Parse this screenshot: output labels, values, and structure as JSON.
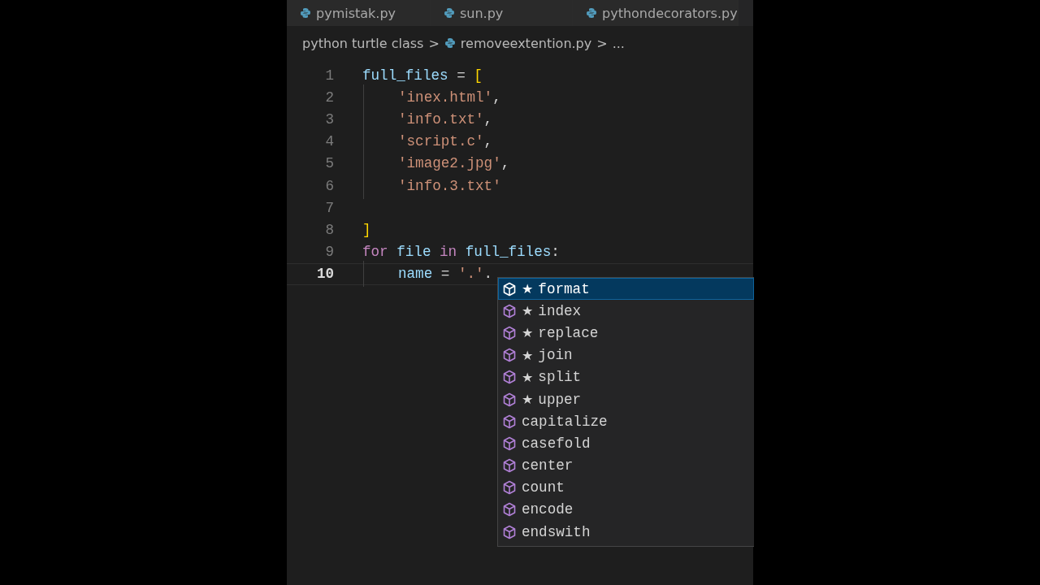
{
  "tabs": [
    {
      "label": "pymistak.py",
      "selected": false
    },
    {
      "label": "sun.py",
      "selected": false
    },
    {
      "label": "pythondecorators.py",
      "selected": false
    }
  ],
  "breadcrumb": {
    "folder": "python turtle class",
    "separator_1": ">",
    "file": "removeextention.py",
    "separator_2": ">",
    "more": "..."
  },
  "code_lines": [
    {
      "number": "1",
      "indented": false,
      "current": false,
      "tokens": [
        {
          "kind": "variable",
          "text": "full_files"
        },
        {
          "kind": "operator",
          "text": " = "
        },
        {
          "kind": "bracket",
          "text": "["
        }
      ]
    },
    {
      "number": "2",
      "indented": true,
      "current": false,
      "tokens": [
        {
          "kind": "string",
          "text": "'inex.html'"
        },
        {
          "kind": "operator",
          "text": ","
        }
      ]
    },
    {
      "number": "3",
      "indented": true,
      "current": false,
      "tokens": [
        {
          "kind": "string",
          "text": "'info.txt'"
        },
        {
          "kind": "operator",
          "text": ","
        }
      ]
    },
    {
      "number": "4",
      "indented": true,
      "current": false,
      "tokens": [
        {
          "kind": "string",
          "text": "'script.c'"
        },
        {
          "kind": "operator",
          "text": ","
        }
      ]
    },
    {
      "number": "5",
      "indented": true,
      "current": false,
      "tokens": [
        {
          "kind": "string",
          "text": "'image2.jpg'"
        },
        {
          "kind": "operator",
          "text": ","
        }
      ]
    },
    {
      "number": "6",
      "indented": true,
      "current": false,
      "tokens": [
        {
          "kind": "string",
          "text": "'info.3.txt'"
        }
      ]
    },
    {
      "number": "7",
      "indented": false,
      "current": false
    },
    {
      "number": "8",
      "indented": false,
      "current": false,
      "tokens": [
        {
          "kind": "bracket",
          "text": "]"
        }
      ]
    },
    {
      "number": "9",
      "indented": false,
      "current": false,
      "tokens": [
        {
          "kind": "keyword",
          "text": "for "
        },
        {
          "kind": "variable",
          "text": "file "
        },
        {
          "kind": "keyword",
          "text": "in "
        },
        {
          "kind": "variable",
          "text": "full_files"
        },
        {
          "kind": "operator",
          "text": ":"
        }
      ]
    },
    {
      "number": "10",
      "indented": true,
      "current": true,
      "tokens": [
        {
          "kind": "variable",
          "text": "name"
        },
        {
          "kind": "operator",
          "text": " = "
        },
        {
          "kind": "string",
          "text": "'.'"
        },
        {
          "kind": "operator",
          "text": "."
        }
      ]
    }
  ],
  "suggestions": [
    {
      "prefix": "★",
      "label": "format",
      "selected": true
    },
    {
      "prefix": "★",
      "label": "index",
      "selected": false
    },
    {
      "prefix": "★",
      "label": "replace",
      "selected": false
    },
    {
      "prefix": "★",
      "label": "join",
      "selected": false
    },
    {
      "prefix": "★",
      "label": "split",
      "selected": false
    },
    {
      "prefix": "★",
      "label": "upper",
      "selected": false
    },
    {
      "label": "capitalize",
      "selected": false
    },
    {
      "label": "casefold",
      "selected": false
    },
    {
      "label": "center",
      "selected": false
    },
    {
      "label": "count",
      "selected": false
    },
    {
      "label": "encode",
      "selected": false
    },
    {
      "label": "endswith",
      "selected": false
    }
  ]
}
